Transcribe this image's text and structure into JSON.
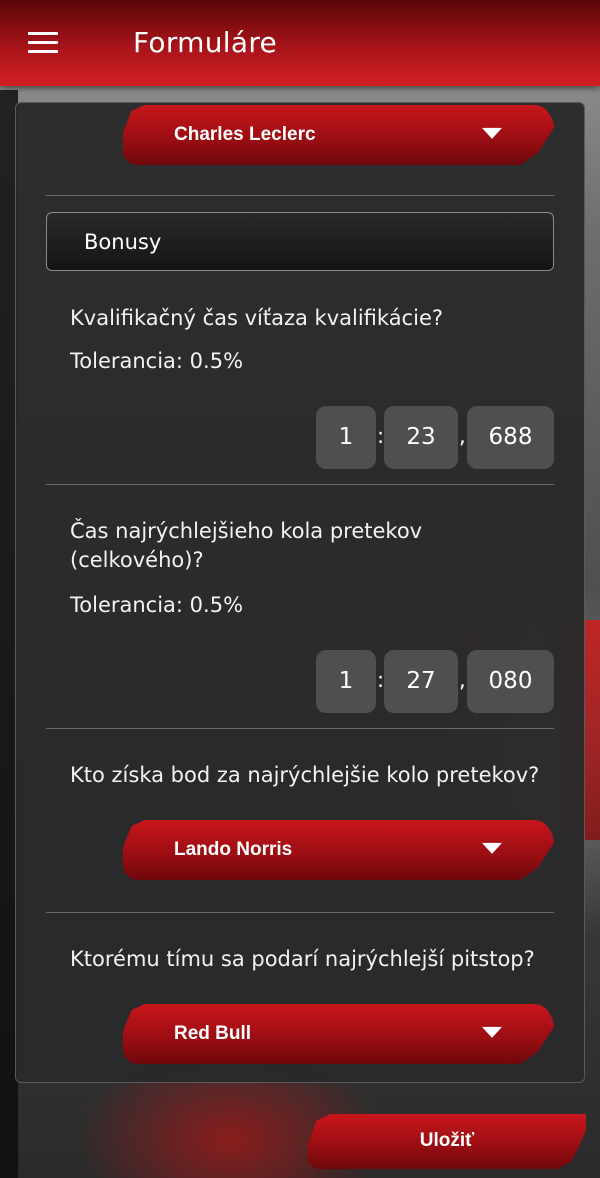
{
  "app": {
    "title": "Formuláre",
    "menu_icon": "hamburger-menu-icon"
  },
  "form": {
    "top_select": {
      "value": "Charles Leclerc",
      "icon": "chevron-down-icon"
    },
    "section_title": "Bonusy",
    "questions": [
      {
        "text": "Kvalifikačný čas víťaza kvalifikácie?",
        "tolerance": "Tolerancia: 0.5%",
        "time": {
          "minutes": "1",
          "sep1": ":",
          "seconds": "23",
          "sep2": ",",
          "millis": "688"
        }
      },
      {
        "text": "Čas najrýchlejšieho kola pretekov (celkového)?",
        "tolerance": "Tolerancia: 0.5%",
        "time": {
          "minutes": "1",
          "sep1": ":",
          "seconds": "27",
          "sep2": ",",
          "millis": "080"
        }
      },
      {
        "text": "Kto získa bod za najrýchlejšie kolo pretekov?",
        "select": {
          "value": "Lando Norris",
          "icon": "chevron-down-icon"
        }
      },
      {
        "text": "Ktorému tímu sa podarí najrýchlejší pitstop?",
        "select": {
          "value": "Red Bull",
          "icon": "chevron-down-icon"
        }
      }
    ]
  },
  "actions": {
    "save_label": "Uložiť"
  },
  "colors": {
    "accent_red": "#c8161c",
    "card_bg": "#2a2a2a",
    "time_box_bg": "#4f4f4f"
  }
}
